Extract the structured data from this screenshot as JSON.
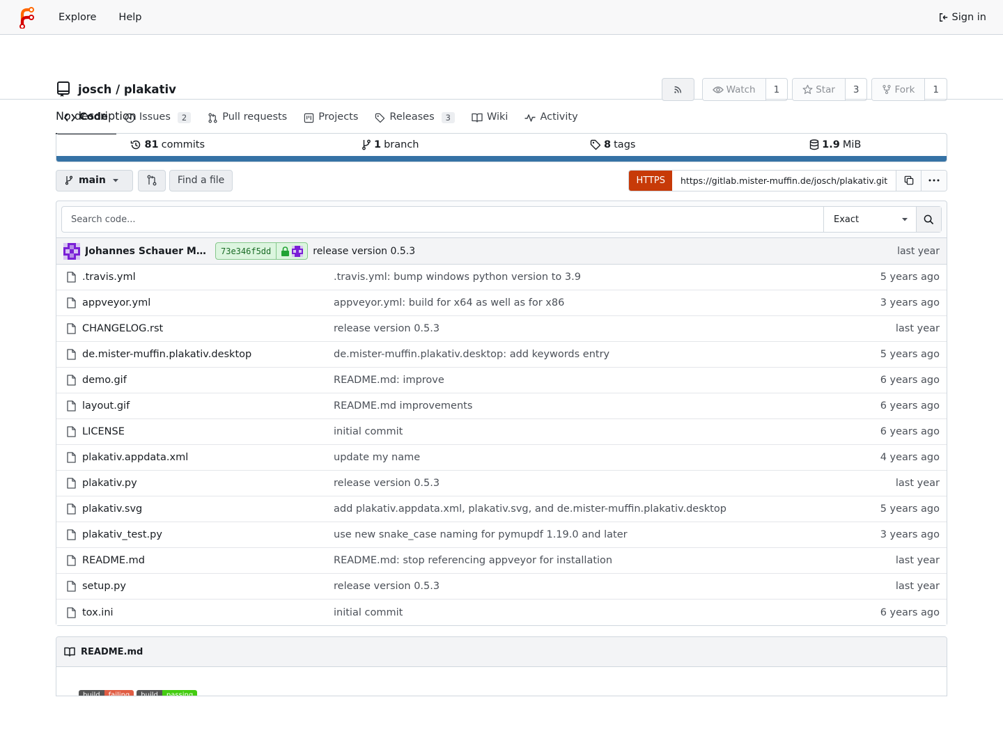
{
  "nav": {
    "explore": "Explore",
    "help": "Help",
    "signin": "Sign in"
  },
  "repo": {
    "title": "josch / plakativ",
    "watch_label": "Watch",
    "watch_count": "1",
    "star_label": "Star",
    "star_count": "3",
    "fork_label": "Fork",
    "fork_count": "1"
  },
  "tabs": [
    {
      "label": "Code",
      "icon": "code-icon"
    },
    {
      "label": "Issues",
      "badge": "2",
      "icon": "issue-icon"
    },
    {
      "label": "Pull requests",
      "icon": "pull-request-icon"
    },
    {
      "label": "Projects",
      "icon": "project-icon"
    },
    {
      "label": "Releases",
      "badge": "3",
      "icon": "tag-icon"
    },
    {
      "label": "Wiki",
      "icon": "book-icon"
    },
    {
      "label": "Activity",
      "icon": "pulse-icon"
    }
  ],
  "description": "No description",
  "stats": {
    "commits_count": "81",
    "commits_label": "commits",
    "branch_count": "1",
    "branch_label": "branch",
    "tags_count": "8",
    "tags_label": "tags",
    "size_value": "1.9",
    "size_unit": "MiB"
  },
  "language_bar": {
    "color": "#3572a5",
    "fraction": 1.0
  },
  "toolbar": {
    "branch": "main",
    "find_file": "Find a file",
    "clone_protocol": "HTTPS",
    "clone_url": "https://gitlab.mister-muffin.de/josch/plakativ.git"
  },
  "search": {
    "placeholder": "Search code...",
    "mode": "Exact"
  },
  "latest_commit": {
    "author": "Johannes Schauer Mari...",
    "sha": "73e346f5dd",
    "message": "release version 0.5.3",
    "time": "last year"
  },
  "files": [
    {
      "name": ".travis.yml",
      "message": ".travis.yml: bump windows python version to 3.9",
      "time": "5 years ago"
    },
    {
      "name": "appveyor.yml",
      "message": "appveyor.yml: build for x64 as well as for x86",
      "time": "3 years ago"
    },
    {
      "name": "CHANGELOG.rst",
      "message": "release version 0.5.3",
      "time": "last year"
    },
    {
      "name": "de.mister-muffin.plakativ.desktop",
      "message": "de.mister-muffin.plakativ.desktop: add keywords entry",
      "time": "5 years ago"
    },
    {
      "name": "demo.gif",
      "message": "README.md: improve",
      "time": "6 years ago"
    },
    {
      "name": "layout.gif",
      "message": "README.md improvements",
      "time": "6 years ago"
    },
    {
      "name": "LICENSE",
      "message": "initial commit",
      "time": "6 years ago"
    },
    {
      "name": "plakativ.appdata.xml",
      "message": "update my name",
      "time": "4 years ago"
    },
    {
      "name": "plakativ.py",
      "message": "release version 0.5.3",
      "time": "last year"
    },
    {
      "name": "plakativ.svg",
      "message": "add plakativ.appdata.xml, plakativ.svg, and de.mister-muffin.plakativ.desktop",
      "time": "5 years ago"
    },
    {
      "name": "plakativ_test.py",
      "message": "use new snake_case naming for pymupdf 1.19.0 and later",
      "time": "3 years ago"
    },
    {
      "name": "README.md",
      "message": "README.md: stop referencing appveyor for installation",
      "time": "last year"
    },
    {
      "name": "setup.py",
      "message": "release version 0.5.3",
      "time": "last year"
    },
    {
      "name": "tox.ini",
      "message": "initial commit",
      "time": "6 years ago"
    }
  ],
  "readme": {
    "title": "README.md",
    "badge1_left": "build",
    "badge1_right": "failing",
    "badge2_left": "build",
    "badge2_right": "passing"
  },
  "colors": {
    "accent": "#c73a08",
    "language_python": "#3572a5",
    "sha_bg": "#dcf5df"
  }
}
